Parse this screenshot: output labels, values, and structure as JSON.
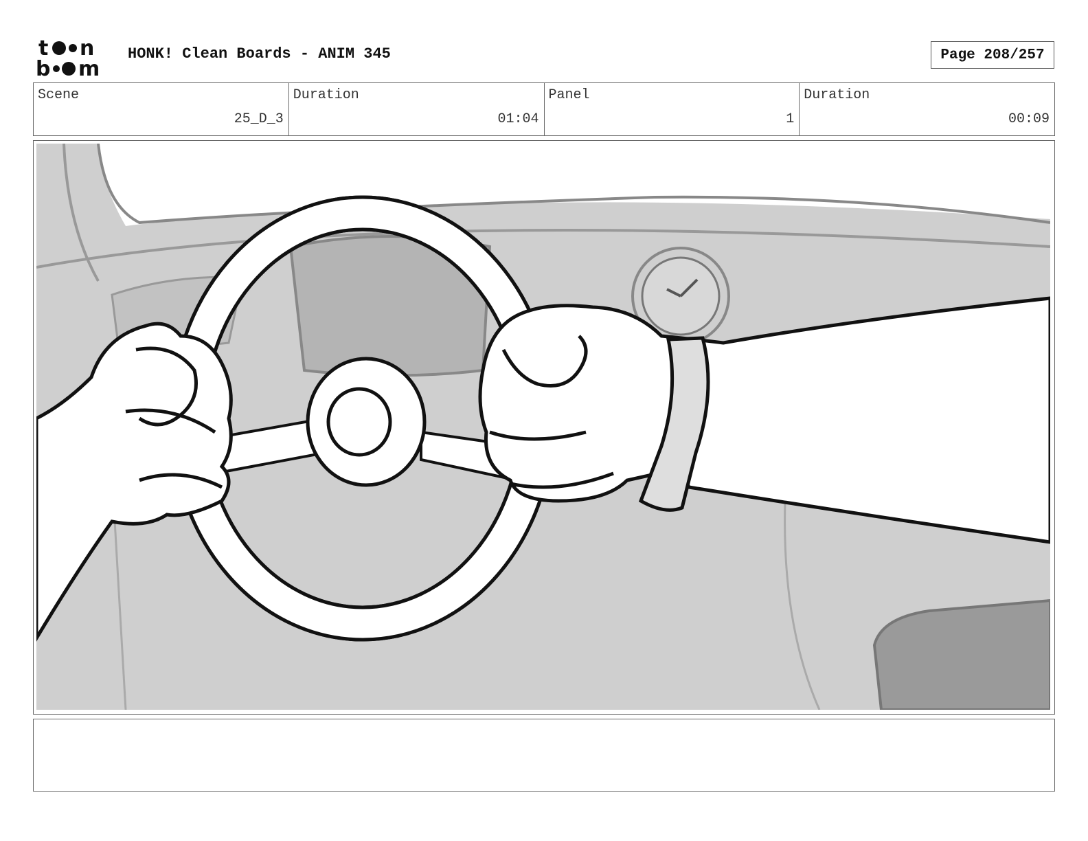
{
  "header": {
    "logo": {
      "line1": "toon",
      "line2": "boom"
    },
    "title": "HONK! Clean Boards - ANIM 345",
    "page": "Page 208/257"
  },
  "info": {
    "scene_label": "Scene",
    "scene_value": "25_D_3",
    "scene_duration_label": "Duration",
    "scene_duration_value": "01:04",
    "panel_label": "Panel",
    "panel_value": "1",
    "panel_duration_label": "Duration",
    "panel_duration_value": "00:09"
  },
  "notes": {
    "text": ""
  }
}
